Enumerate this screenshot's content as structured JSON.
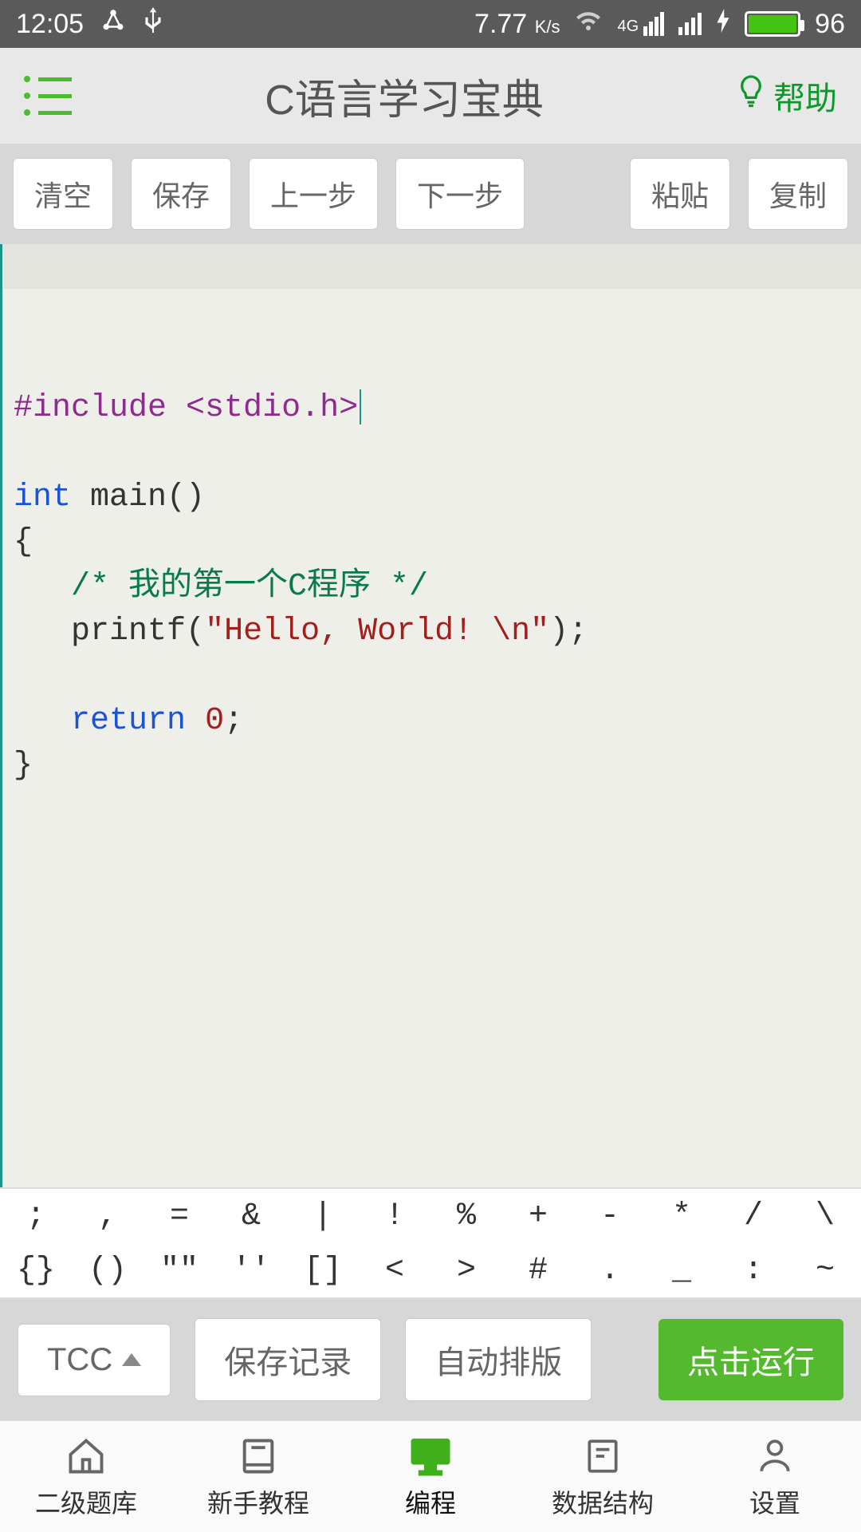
{
  "statusbar": {
    "time": "12:05",
    "net_speed": "7.77",
    "net_unit": "K/s",
    "network_label": "4G",
    "battery_pct": "96"
  },
  "header": {
    "title": "C语言学习宝典",
    "help_label": "帮助"
  },
  "toolbar": {
    "clear": "清空",
    "save": "保存",
    "undo": "上一步",
    "redo": "下一步",
    "paste": "粘贴",
    "copy": "复制"
  },
  "code": {
    "line1_include": "#include",
    "line1_header": "<stdio.h>",
    "line3_kw1": "int",
    "line3_fn": " main()",
    "line4": "{",
    "line5_comment": "/* 我的第一个C程序 */",
    "line6_fn": "printf",
    "line6_open": "(",
    "line6_str": "\"Hello, World! \\n\"",
    "line6_close": ");",
    "line8_kw": "return",
    "line8_num": "0",
    "line8_end": ";",
    "line9": "}"
  },
  "symbols": {
    "row1": [
      ";",
      ",",
      "=",
      "&",
      "|",
      "!",
      "%",
      "+",
      "-",
      "*",
      "/",
      "\\"
    ],
    "row2": [
      "{}",
      "()",
      "\"\"",
      "''",
      "[]",
      "<",
      ">",
      "#",
      ".",
      "_",
      ":",
      "~"
    ]
  },
  "actions": {
    "compiler": "TCC",
    "save_record": "保存记录",
    "auto_format": "自动排版",
    "run": "点击运行"
  },
  "nav": {
    "items": [
      {
        "label": "二级题库"
      },
      {
        "label": "新手教程"
      },
      {
        "label": "编程"
      },
      {
        "label": "数据结构"
      },
      {
        "label": "设置"
      }
    ]
  }
}
